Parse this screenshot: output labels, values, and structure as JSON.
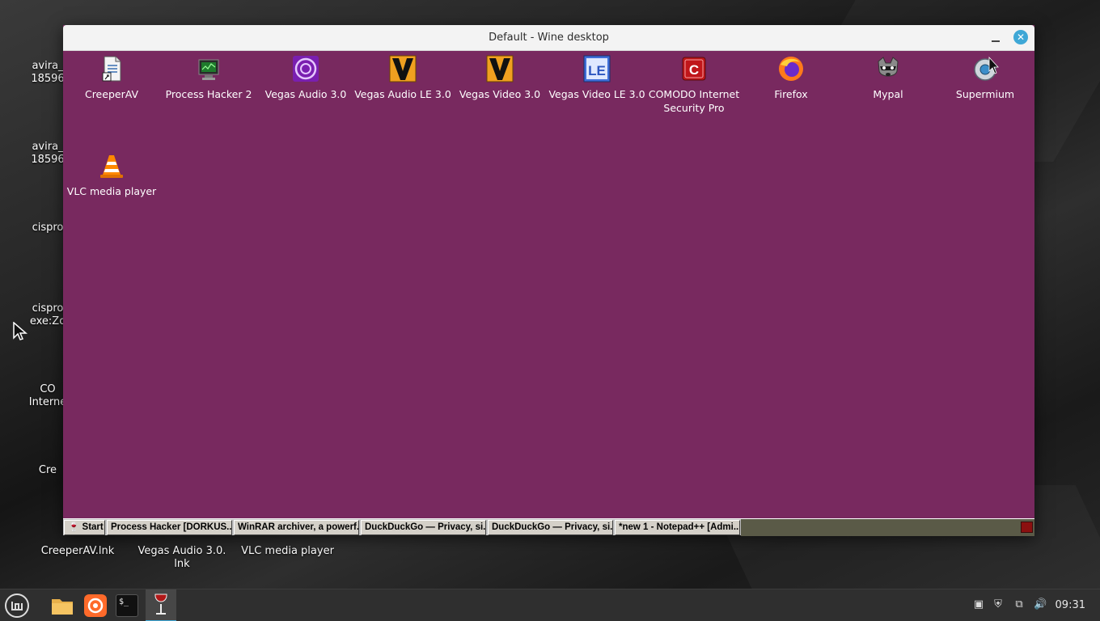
{
  "host_desktop": {
    "left_icons": [
      {
        "label_line1": "avira_",
        "label_line2": "18596"
      },
      {
        "label_line1": "avira_",
        "label_line2": "18596"
      },
      {
        "label_line1": "cispro",
        "label_line2": ""
      },
      {
        "label_line1": "cispro",
        "label_line2": "exe:Zo"
      },
      {
        "label_line1": "CO",
        "label_line2": "Interne"
      },
      {
        "label_line1": "Cre",
        "label_line2": ""
      }
    ],
    "bottom_icons": [
      {
        "label": "CreeperAV.lnk"
      },
      {
        "label": "Vegas Audio 3.0.",
        "label2": "lnk"
      },
      {
        "label": "VLC media player"
      }
    ]
  },
  "wine_window": {
    "title": "Default - Wine desktop",
    "close_glyph": "✕",
    "desktop_icons": [
      {
        "label": "CreeperAV",
        "icon": "document-shortcut-icon"
      },
      {
        "label": "Process Hacker 2",
        "icon": "process-hacker-icon"
      },
      {
        "label": "Vegas Audio 3.0",
        "icon": "vegas-audio-icon"
      },
      {
        "label": "Vegas Audio LE 3.0",
        "icon": "vegas-v-icon"
      },
      {
        "label": "Vegas Video 3.0",
        "icon": "vegas-v-icon"
      },
      {
        "label": "Vegas Video LE 3.0",
        "icon": "vegas-le-icon"
      },
      {
        "label": "COMODO Internet",
        "label2": "Security Pro",
        "icon": "comodo-icon"
      },
      {
        "label": "Firefox",
        "icon": "firefox-icon"
      },
      {
        "label": "Mypal",
        "icon": "mypal-icon"
      },
      {
        "label": "Supermium",
        "icon": "supermium-icon"
      },
      {
        "label": "VLC media player",
        "icon": "vlc-cone-icon"
      }
    ],
    "taskbar": {
      "start_label": "Start",
      "buttons": [
        "Process Hacker [DORKUS...",
        "WinRAR archiver, a powerf...",
        "DuckDuckGo — Privacy, si...",
        "DuckDuckGo — Privacy, si...",
        "*new 1 - Notepad++ [Admi..."
      ]
    }
  },
  "host_panel": {
    "clock": "09:31",
    "launchers": [
      "menu-icon",
      "files-folder-icon",
      "firefox-icon",
      "terminal-icon",
      "wine-glass-icon"
    ],
    "terminal_glyph": "$_"
  },
  "colors": {
    "wine_desktop_bg": "#78295f",
    "titlebar_bg": "#f3f3f3",
    "close_button": "#3ea7d6",
    "host_panel_bg": "#2f2f2f"
  }
}
